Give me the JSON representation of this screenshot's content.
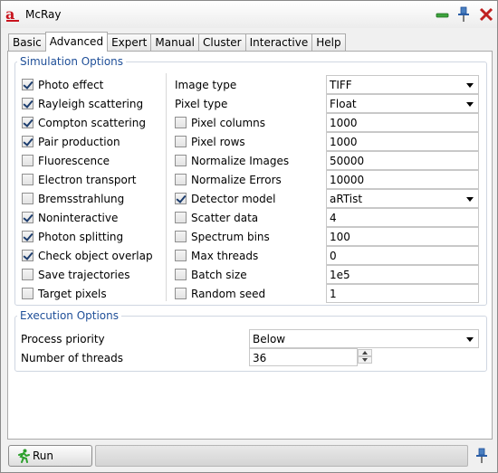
{
  "window": {
    "title": "McRay"
  },
  "tabs": [
    {
      "label": "Basic",
      "active": false
    },
    {
      "label": "Advanced",
      "active": true
    },
    {
      "label": "Expert",
      "active": false
    },
    {
      "label": "Manual",
      "active": false
    },
    {
      "label": "Cluster",
      "active": false
    },
    {
      "label": "Interactive",
      "active": false
    },
    {
      "label": "Help",
      "active": false
    }
  ],
  "simulation": {
    "title": "Simulation Options",
    "effects": [
      {
        "label": "Photo effect",
        "checked": true
      },
      {
        "label": "Rayleigh scattering",
        "checked": true
      },
      {
        "label": "Compton scattering",
        "checked": true
      },
      {
        "label": "Pair production",
        "checked": true
      },
      {
        "label": "Fluorescence",
        "checked": false
      },
      {
        "label": "Electron transport",
        "checked": false
      },
      {
        "label": "Bremsstrahlung",
        "checked": false
      },
      {
        "label": "Noninteractive",
        "checked": true
      },
      {
        "label": "Photon splitting",
        "checked": true
      },
      {
        "label": "Check object overlap",
        "checked": true
      },
      {
        "label": "Save trajectories",
        "checked": false
      },
      {
        "label": "Target pixels",
        "checked": false
      }
    ],
    "image_type": {
      "label": "Image type",
      "value": "TIFF"
    },
    "pixel_type": {
      "label": "Pixel type",
      "value": "Float"
    },
    "params": [
      {
        "label": "Pixel columns",
        "checked": false,
        "value": "1000",
        "combo": false
      },
      {
        "label": "Pixel rows",
        "checked": false,
        "value": "1000",
        "combo": false
      },
      {
        "label": "Normalize Images",
        "checked": false,
        "value": "50000",
        "combo": false
      },
      {
        "label": "Normalize Errors",
        "checked": false,
        "value": "10000",
        "combo": false
      },
      {
        "label": "Detector model",
        "checked": true,
        "value": "aRTist",
        "combo": true
      },
      {
        "label": "Scatter data",
        "checked": false,
        "value": "4",
        "combo": false
      },
      {
        "label": "Spectrum bins",
        "checked": false,
        "value": "100",
        "combo": false
      },
      {
        "label": "Max threads",
        "checked": false,
        "value": "0",
        "combo": false
      },
      {
        "label": "Batch size",
        "checked": false,
        "value": "1e5",
        "combo": false
      },
      {
        "label": "Random seed",
        "checked": false,
        "value": "1",
        "combo": false
      }
    ]
  },
  "execution": {
    "title": "Execution Options",
    "priority_label": "Process priority",
    "priority_value": "Below",
    "threads_label": "Number of threads",
    "threads_value": "36"
  },
  "footer": {
    "run_label": "Run"
  }
}
